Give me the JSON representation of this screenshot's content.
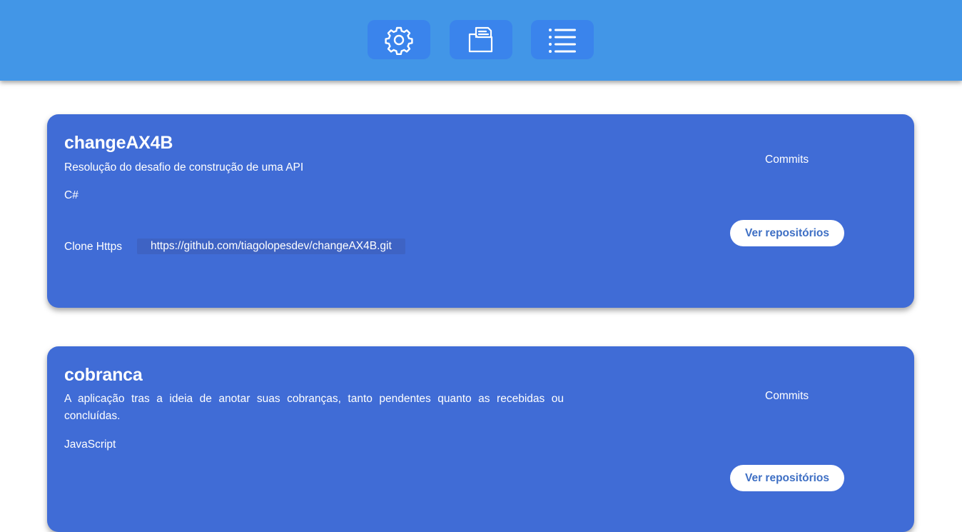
{
  "nav": {
    "buttons": [
      {
        "icon": "gear-icon"
      },
      {
        "icon": "folder-document-icon"
      },
      {
        "icon": "list-icon"
      }
    ]
  },
  "repos": [
    {
      "name": "changeAX4B",
      "description": "Resolução do desafio de construção de uma API",
      "language": "C#",
      "clone_label": "Clone Https",
      "clone_url": "https://github.com/tiagolopesdev/changeAX4B.git",
      "commits_label": "Commits",
      "button_label": "Ver repositórios"
    },
    {
      "name": "cobranca",
      "description": "A aplicação tras a ideia de anotar suas cobranças, tanto pendentes quanto as recebidas ou concluídas.",
      "language": "JavaScript",
      "commits_label": "Commits",
      "button_label": "Ver repositórios"
    }
  ],
  "colors": {
    "header": "#4296e7",
    "nav_button": "#3a84ec",
    "card": "#406cd6",
    "clone_url_bg": "#3e63c4",
    "button_text": "#3e6fc4"
  }
}
